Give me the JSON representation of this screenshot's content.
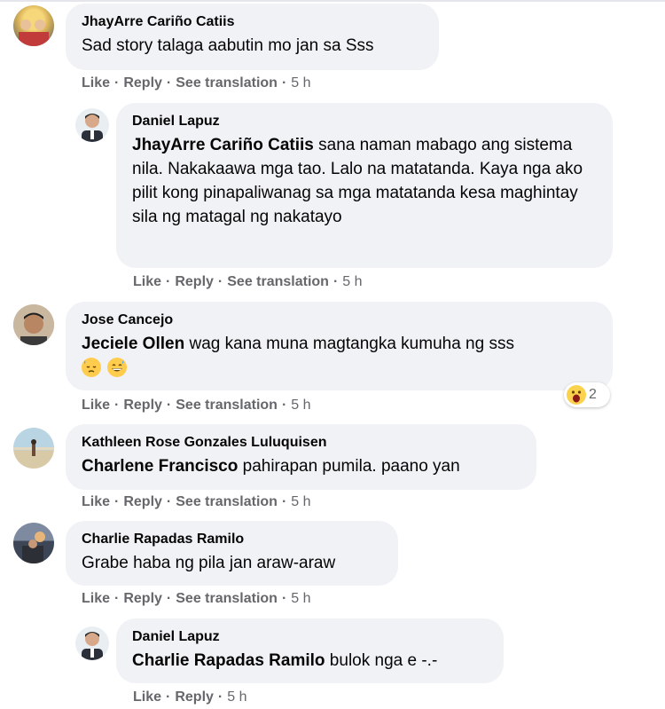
{
  "actions": {
    "like": "Like",
    "reply": "Reply",
    "see_translation": "See translation",
    "separator": "·"
  },
  "colors": {
    "bubble": "#f0f2f5",
    "meta_text": "#65676b",
    "text": "#050505"
  },
  "comments": [
    {
      "author": "JhayArre Cariño Catiis",
      "mention": "",
      "text": "Sad story talaga aabutin mo jan sa Sss",
      "time": "5 h"
    },
    {
      "author": "Daniel Lapuz",
      "mention": "JhayArre Cariño Catiis",
      "text": " sana naman mabago ang sistema nila. Nakakaawa mga tao. Lalo na matatanda. Kaya nga ako pilit kong pinapaliwanag sa mga matatanda kesa maghintay sila ng matagal ng nakatayo",
      "time": "5 h"
    },
    {
      "author": "Jose Cancejo",
      "mention": "Jeciele Ollen",
      "text": " wag kana muna magtangka kumuha ng sss",
      "emojis": [
        "downcast-sweat-emoji",
        "grinning-sweat-emoji"
      ],
      "reaction": {
        "icon": "wow-reaction-icon",
        "count": "2"
      },
      "time": "5 h"
    },
    {
      "author": "Kathleen Rose Gonzales Luluquisen",
      "mention": "Charlene Francisco",
      "text": " pahirapan pumila. paano yan",
      "time": "5 h"
    },
    {
      "author": "Charlie Rapadas Ramilo",
      "mention": "",
      "text": "Grabe haba ng pila jan araw-araw",
      "time": "5 h"
    },
    {
      "author": "Daniel Lapuz",
      "mention": "Charlie Rapadas Ramilo",
      "text": " bulok nga e -.-",
      "time": "5 h"
    }
  ]
}
